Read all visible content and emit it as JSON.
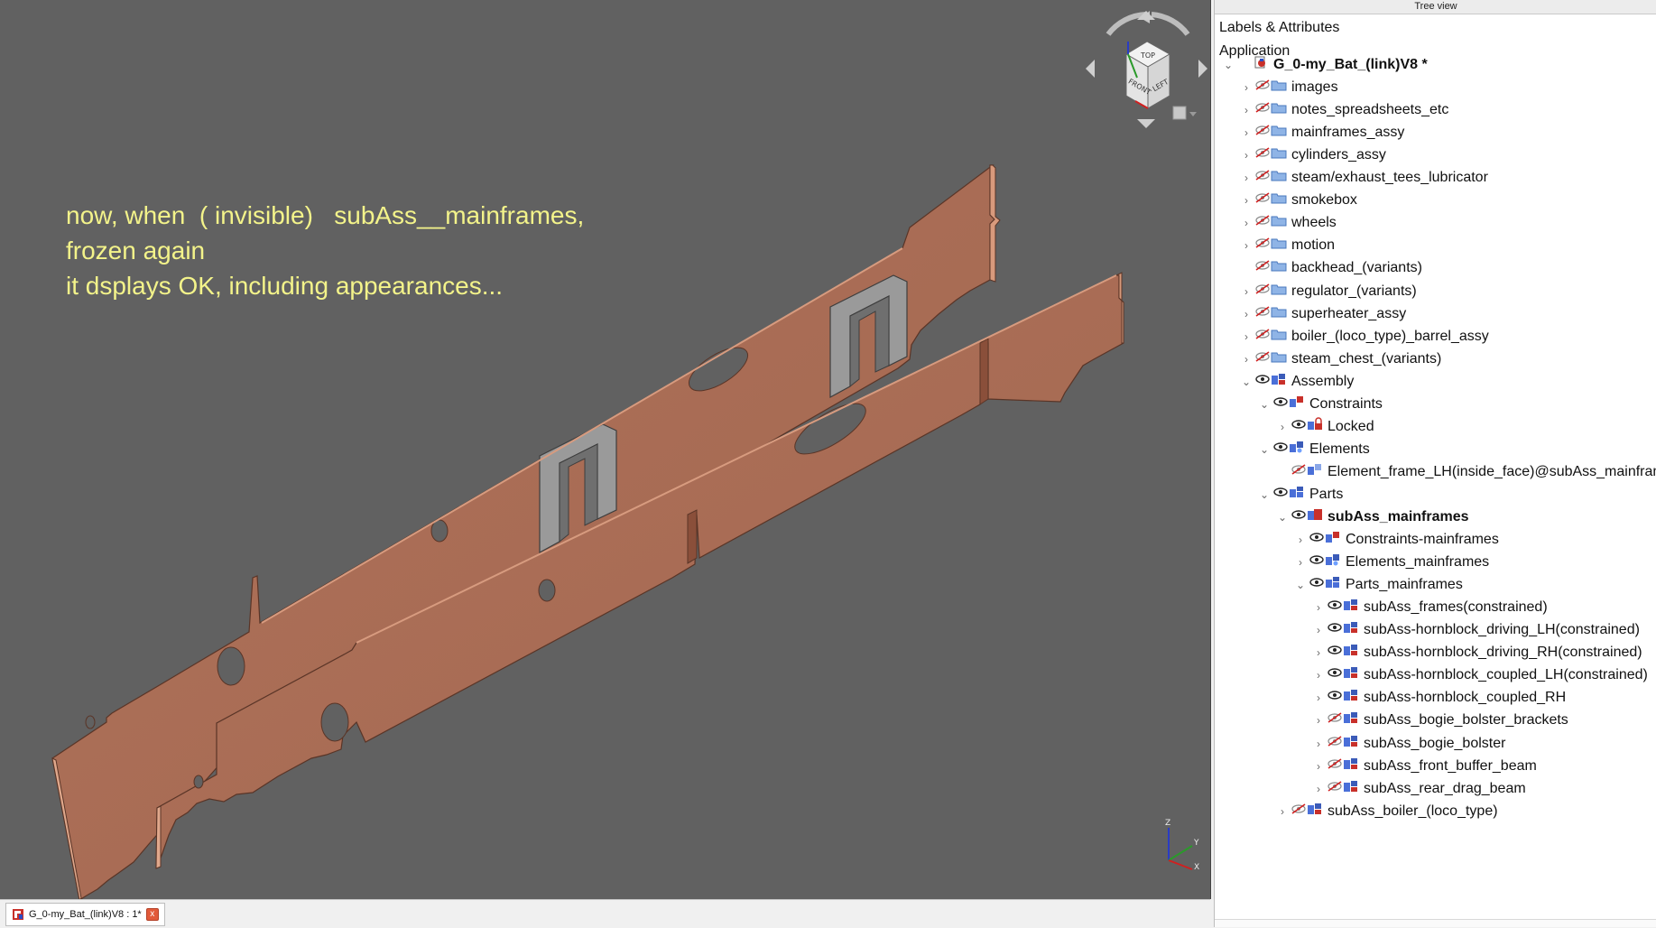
{
  "viewport": {
    "annotation": [
      "now, when  ( invisible)   subAss__mainframes,",
      "frozen again",
      "it dsplays OK, including appearances..."
    ],
    "nav_cube_faces": [
      "TOP",
      "FRONT",
      "LEFT"
    ],
    "axis_labels": [
      "Z",
      "Y",
      "X"
    ]
  },
  "doc_tab": {
    "label": "G_0-my_Bat_(link)V8 : 1*",
    "close": "x"
  },
  "tree": {
    "panel_title": "Tree view",
    "header1": "Labels & Attributes",
    "header2": "Application",
    "rows": [
      {
        "label": "G_0-my_Bat_(link)V8 *",
        "chev": "v",
        "vis": "none",
        "icon": "doc",
        "bold": true
      },
      {
        "label": "images",
        "chev": ">",
        "vis": "hidden",
        "icon": "folder"
      },
      {
        "label": "notes_spreadsheets_etc",
        "chev": ">",
        "vis": "hidden",
        "icon": "folder"
      },
      {
        "label": "mainframes_assy",
        "chev": ">",
        "vis": "hidden",
        "icon": "folder"
      },
      {
        "label": "cylinders_assy",
        "chev": ">",
        "vis": "hidden",
        "icon": "folder"
      },
      {
        "label": "steam/exhaust_tees_lubricator",
        "chev": ">",
        "vis": "hidden",
        "icon": "folder"
      },
      {
        "label": "smokebox",
        "chev": ">",
        "vis": "hidden",
        "icon": "folder"
      },
      {
        "label": "wheels",
        "chev": ">",
        "vis": "hidden",
        "icon": "folder"
      },
      {
        "label": "motion",
        "chev": ">",
        "vis": "hidden",
        "icon": "folder"
      },
      {
        "label": "backhead_(variants)",
        "chev": "",
        "vis": "hidden",
        "icon": "folder"
      },
      {
        "label": "regulator_(variants)",
        "chev": ">",
        "vis": "hidden",
        "icon": "folder"
      },
      {
        "label": "superheater_assy",
        "chev": ">",
        "vis": "hidden",
        "icon": "folder"
      },
      {
        "label": "boiler_(loco_type)_barrel_assy",
        "chev": ">",
        "vis": "hidden",
        "icon": "folder"
      },
      {
        "label": "steam_chest_(variants)",
        "chev": ">",
        "vis": "hidden",
        "icon": "folder"
      },
      {
        "label": "Assembly",
        "chev": "v",
        "vis": "shown",
        "icon": "assembly"
      },
      {
        "label": "Constraints",
        "chev": "v",
        "vis": "shown",
        "icon": "constraints"
      },
      {
        "label": "Locked",
        "chev": ">",
        "vis": "shown",
        "icon": "locked"
      },
      {
        "label": "Elements",
        "chev": "v",
        "vis": "shown",
        "icon": "elements"
      },
      {
        "label": "Element_frame_LH(inside_face)@subAss_mainframes",
        "chev": "",
        "vis": "hidden",
        "icon": "element"
      },
      {
        "label": "Parts",
        "chev": "v",
        "vis": "shown",
        "icon": "parts"
      },
      {
        "label": "subAss_mainframes",
        "chev": "v",
        "vis": "shown",
        "icon": "subass-red",
        "bold": true
      },
      {
        "label": "Constraints-mainframes",
        "chev": ">",
        "vis": "shown",
        "icon": "constraints"
      },
      {
        "label": "Elements_mainframes",
        "chev": ">",
        "vis": "shown",
        "icon": "elements"
      },
      {
        "label": "Parts_mainframes",
        "chev": "v",
        "vis": "shown",
        "icon": "parts"
      },
      {
        "label": "subAss_frames(constrained)",
        "chev": ">",
        "vis": "shown",
        "icon": "assembly"
      },
      {
        "label": "subAss-hornblock_driving_LH(constrained)",
        "chev": ">",
        "vis": "shown",
        "icon": "assembly"
      },
      {
        "label": "subAss-hornblock_driving_RH(constrained)",
        "chev": ">",
        "vis": "shown",
        "icon": "assembly"
      },
      {
        "label": "subAss-hornblock_coupled_LH(constrained)",
        "chev": ">",
        "vis": "shown",
        "icon": "assembly"
      },
      {
        "label": "subAss-hornblock_coupled_RH",
        "chev": ">",
        "vis": "shown",
        "icon": "assembly"
      },
      {
        "label": "subAss_bogie_bolster_brackets",
        "chev": ">",
        "vis": "hidden",
        "icon": "assembly"
      },
      {
        "label": "subAss_bogie_bolster",
        "chev": ">",
        "vis": "hidden",
        "icon": "assembly"
      },
      {
        "label": "subAss_front_buffer_beam",
        "chev": ">",
        "vis": "hidden",
        "icon": "assembly"
      },
      {
        "label": "subAss_rear_drag_beam",
        "chev": ">",
        "vis": "hidden",
        "icon": "assembly"
      },
      {
        "label": "subAss_boiler_(loco_type)",
        "chev": ">",
        "vis": "hidden",
        "icon": "assembly"
      }
    ]
  }
}
